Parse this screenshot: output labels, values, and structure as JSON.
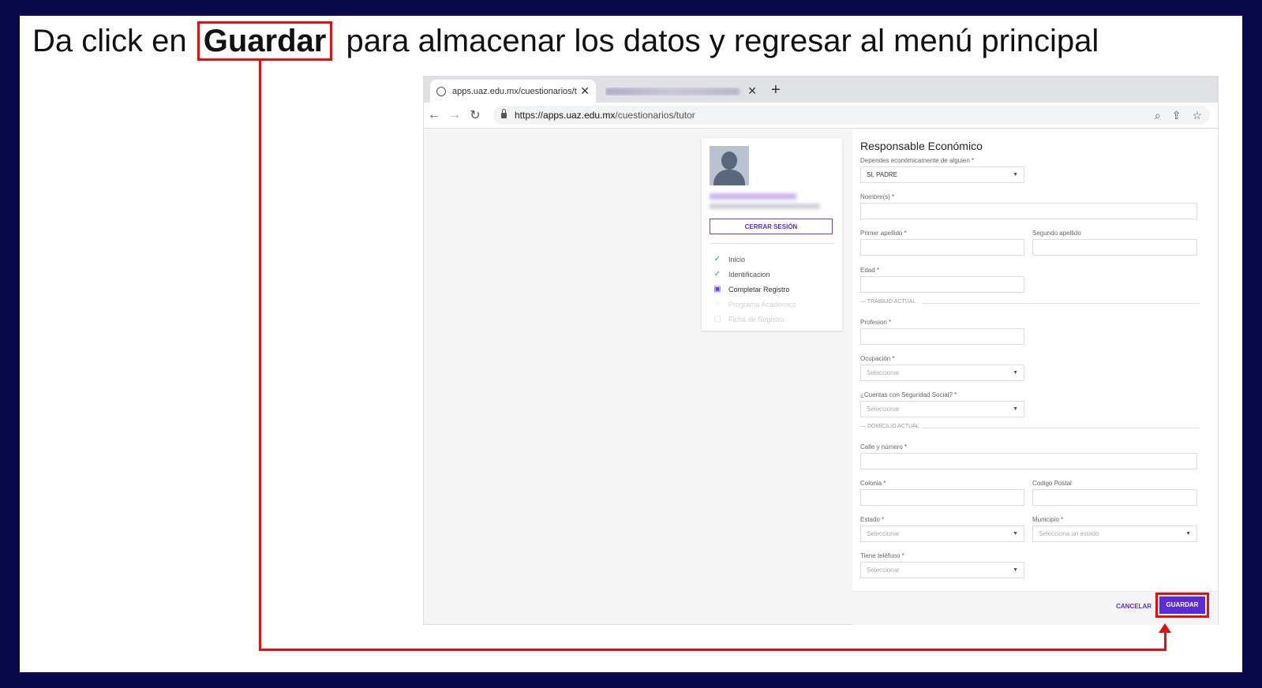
{
  "instruction": {
    "prefix": "Da click en",
    "highlight": "Guardar",
    "suffix": "para almacenar los datos y regresar al menú principal"
  },
  "browser": {
    "tab_title": "apps.uaz.edu.mx/cuestionarios/tu",
    "url_prefix": "https://",
    "url_domain": "apps.uaz.edu.mx",
    "url_path": "/cuestionarios/tutor"
  },
  "sidebar": {
    "logout_label": "CERRAR SESIÓN",
    "steps": [
      {
        "label": "Inicio",
        "state": "done"
      },
      {
        "label": "Identificacion",
        "state": "done"
      },
      {
        "label": "Completar Registro",
        "state": "current"
      },
      {
        "label": "Programa Académico",
        "state": "pending"
      },
      {
        "label": "Ficha de Registro",
        "state": "pending"
      }
    ]
  },
  "form": {
    "title": "Responsable Económico",
    "depende_label": "Dependes económicamente de alguien *",
    "depende_value": "SI, PADRE",
    "nombre_label": "Nombre(s) *",
    "primer_apellido_label": "Primer apellido *",
    "segundo_apellido_label": "Segundo apellido",
    "edad_label": "Edad *",
    "section_trabajo": "TRABAJO ACTUAL",
    "profesion_label": "Profesion *",
    "ocupacion_label": "Ocupación *",
    "ocupacion_placeholder": "Seleccionar",
    "seguridad_label": "¿Cuentas con Seguridad Social? *",
    "seguridad_placeholder": "Seleccionar",
    "section_domicilio": "DOMICILIO ACTUAL",
    "calle_label": "Calle y número *",
    "colonia_label": "Colonia *",
    "cp_label": "Codigo Postal",
    "estado_label": "Estado *",
    "estado_placeholder": "Seleccionar",
    "municipio_label": "Municipio *",
    "municipio_placeholder": "Selecciona un estado",
    "telefono_label": "Tiene teléfono *",
    "telefono_placeholder": "Seleccionar",
    "cancel_label": "CANCELAR",
    "save_label": "GUARDAR"
  }
}
